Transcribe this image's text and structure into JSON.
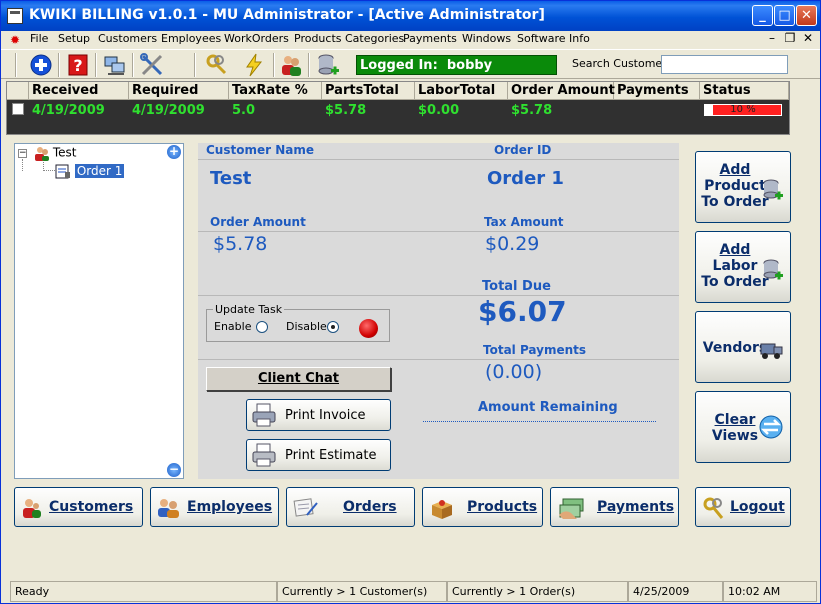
{
  "window": {
    "title": "KWIKI BILLING v1.0.1 - MU Administrator - [Active Administrator]",
    "minimize_label": "_",
    "maximize_label": "□",
    "close_label": "✕"
  },
  "menu": {
    "items": [
      "File",
      "Setup",
      "Customers",
      "Employees",
      "WorkOrders",
      "Products Categories",
      "Payments",
      "Windows",
      "Software Info"
    ],
    "mdi_minimize": "–",
    "mdi_restore": "❐",
    "mdi_close": "✕"
  },
  "toolbar": {
    "logged_in_label": "Logged In:",
    "logged_in_user": "bobby",
    "search_label": "Search Customer :",
    "search_value": ""
  },
  "grid": {
    "columns": [
      "Received",
      "Required",
      "TaxRate %",
      "PartsTotal",
      "LaborTotal",
      "Order Amount",
      "Payments",
      "Status"
    ],
    "row": {
      "received": "4/19/2009",
      "required": "4/19/2009",
      "taxrate": "5.0",
      "partstotal": "$5.78",
      "labortotal": "$0.00",
      "order_amount": "$5.78",
      "payments": "",
      "status_progress": 0.1,
      "status_label": "10 %"
    }
  },
  "tree": {
    "root": "Test",
    "child": "Order 1",
    "expand_label": "−",
    "add_label": "+",
    "remove_label": "−"
  },
  "order": {
    "customer_name_label": "Customer Name",
    "customer_name": "Test",
    "order_id_label": "Order ID",
    "order_id": "Order  1",
    "order_amount_label": "Order Amount",
    "order_amount": "$5.78",
    "tax_amount_label": "Tax Amount",
    "tax_amount": "$0.29",
    "total_due_label": "Total Due",
    "total_due": "$6.07",
    "total_payments_label": "Total Payments",
    "total_payments": "(0.00)",
    "amount_remaining_label": "Amount Remaining",
    "update_task_label": "Update Task",
    "enable_label": "Enable",
    "disable_label": "Disable",
    "client_chat_label": "Client Chat",
    "print_invoice_label": "Print Invoice",
    "print_estimate_label": "Print Estimate"
  },
  "side_buttons": {
    "add_product": [
      "Add",
      "Product",
      "To Order"
    ],
    "add_labor": [
      "Add",
      "Labor",
      "To Order"
    ],
    "vendors": "Vendors",
    "clear_views": [
      "Clear",
      "Views"
    ]
  },
  "nav": {
    "customers": "Customers",
    "employees": "Employees",
    "orders": "Orders",
    "products": "Products",
    "payments": "Payments",
    "logout": "Logout"
  },
  "status": {
    "ready": "Ready",
    "customers": "Currently > 1 Customer(s)",
    "orders": "Currently > 1 Order(s)",
    "date": "4/25/2009",
    "time": "10:02 AM"
  }
}
